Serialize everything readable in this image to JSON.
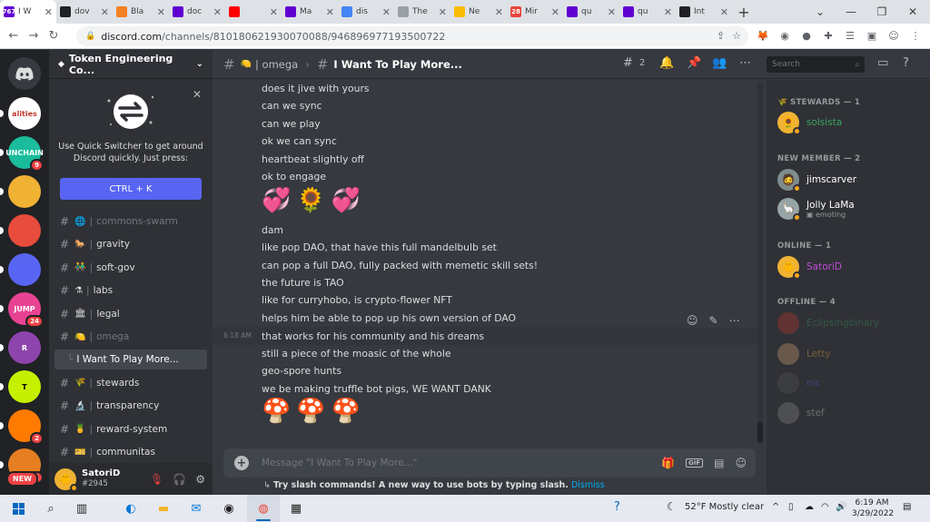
{
  "browser": {
    "tabs": [
      {
        "badge": "767",
        "title": "I W",
        "color": "#6001d2"
      },
      {
        "title": "dov",
        "color": "#202124"
      },
      {
        "title": "Bla",
        "color": "#f48024"
      },
      {
        "title": "doc",
        "color": "#6001d2"
      },
      {
        "title": "",
        "color": "#ff0000"
      },
      {
        "title": "Ma",
        "color": "#6001d2"
      },
      {
        "title": "dis",
        "color": "#4285f4"
      },
      {
        "title": "The",
        "color": "#9aa0a6"
      },
      {
        "title": "Ne",
        "color": "#fbbc04"
      },
      {
        "badge": "28",
        "title": "Mir",
        "color": "#e8453c"
      },
      {
        "title": "qu",
        "color": "#6001d2"
      },
      {
        "title": "qu",
        "color": "#6001d2"
      },
      {
        "title": "Int",
        "color": "#202124"
      }
    ],
    "new_tab": "+",
    "url_host": "discord.com",
    "url_path": "/channels/810180621930070088/946896977193500722"
  },
  "discord": {
    "server_name": "Token Engineering Co...",
    "guilds": [
      {
        "label": "alities",
        "color": "#ffffff",
        "text": "#c0392b"
      },
      {
        "label": "UNCHAIN",
        "color": "#1abc9c",
        "badge": "9"
      },
      {
        "label": "",
        "color": "#f0b232"
      },
      {
        "label": "",
        "color": "#e74c3c"
      },
      {
        "label": "",
        "color": "#5865f2"
      },
      {
        "label": "JUMP",
        "color": "#e84393",
        "badge": "24"
      },
      {
        "label": "R",
        "color": "#8e44ad"
      },
      {
        "label": "T",
        "color": "#c7f000",
        "text": "#000000"
      },
      {
        "label": "",
        "color": "#ff7a00",
        "badge": "2"
      },
      {
        "label": "",
        "color": "#e67e22",
        "badge": "11"
      }
    ],
    "new_badge": "NEW",
    "quick_switcher": {
      "hint": "Use Quick Switcher to get around Discord quickly. Just press:",
      "shortcut": "CTRL + K"
    },
    "channels": [
      {
        "name": "commons-swarm",
        "emoji": "🌐",
        "muted": true
      },
      {
        "name": "gravity",
        "emoji": "🐎",
        "muted": false
      },
      {
        "name": "soft-gov",
        "emoji": "👬",
        "muted": false
      },
      {
        "name": "labs",
        "emoji": "⚗",
        "muted": false
      },
      {
        "name": "legal",
        "emoji": "🏛",
        "muted": false
      },
      {
        "name": "omega",
        "emoji": "🍋",
        "muted": true
      },
      {
        "name": "I Want To Play More...",
        "thread": true,
        "selected": true
      },
      {
        "name": "stewards",
        "emoji": "🌾",
        "muted": false
      },
      {
        "name": "transparency",
        "emoji": "🔬",
        "muted": false
      },
      {
        "name": "reward-system",
        "emoji": "🍍",
        "muted": false
      },
      {
        "name": "communitas",
        "emoji": "🎫",
        "muted": false
      }
    ],
    "user": {
      "name": "SatoriD",
      "tag": "#2945"
    },
    "header": {
      "parent_channel": "| omega",
      "thread": "I Want To Play More...",
      "thread_count": "2",
      "search_placeholder": "Search"
    },
    "messages": [
      "does it jive with yours",
      "can we sync",
      "can we play",
      "ok we can sync",
      "heartbeat slightly off",
      "ok to engage",
      "dam",
      "like pop DAO, that have this full mandelbulb set",
      "can pop a full DAO, fully packed with memetic skill sets!",
      "the future is TAO",
      "like for curryhobo, is crypto-flower NFT",
      "helps him be able to pop up his own version of DAO",
      "that works for his community and his dreams",
      "still a piece of the moasic of the whole",
      "geo-spore hunts",
      "we be making truffle bot pigs, WE WANT DANK"
    ],
    "emoji_rows": [
      [
        "💞",
        "🌻",
        "💞"
      ],
      [
        "🍄",
        "🍄",
        "🍄"
      ]
    ],
    "hover_timestamp": "6:18 AM",
    "composer_placeholder": "Message \"I Want To Play More...\"",
    "slash_tip": "Try slash commands! A new way to use bots by typing slash.",
    "slash_dismiss": "Dismiss",
    "gif_label": "GIF",
    "members": {
      "stewards_header": "STEWARDS — 1",
      "new_member_header": "NEW MEMBER — 2",
      "online_header": "ONLINE — 1",
      "offline_header": "OFFLINE — 4",
      "stewards": [
        {
          "name": "solsista",
          "color": "#3ba55d"
        }
      ],
      "new_members": [
        {
          "name": "jimscarver",
          "color": "#ffffff"
        },
        {
          "name": "Jolly LaMa",
          "color": "#ffffff",
          "activity": "emoting"
        }
      ],
      "online": [
        {
          "name": "SatoriD",
          "color": "#c04dd6"
        }
      ],
      "offline": [
        {
          "name": "Eclipsingbinary",
          "color": "#3ba55d"
        },
        {
          "name": "Letty",
          "color": "#f0b232"
        },
        {
          "name": "nic",
          "color": "#5865f2"
        },
        {
          "name": "stef",
          "color": "#dcddde"
        }
      ]
    }
  },
  "taskbar": {
    "weather": "52°F  Mostly clear",
    "time": "6:19 AM",
    "date": "3/29/2022"
  }
}
